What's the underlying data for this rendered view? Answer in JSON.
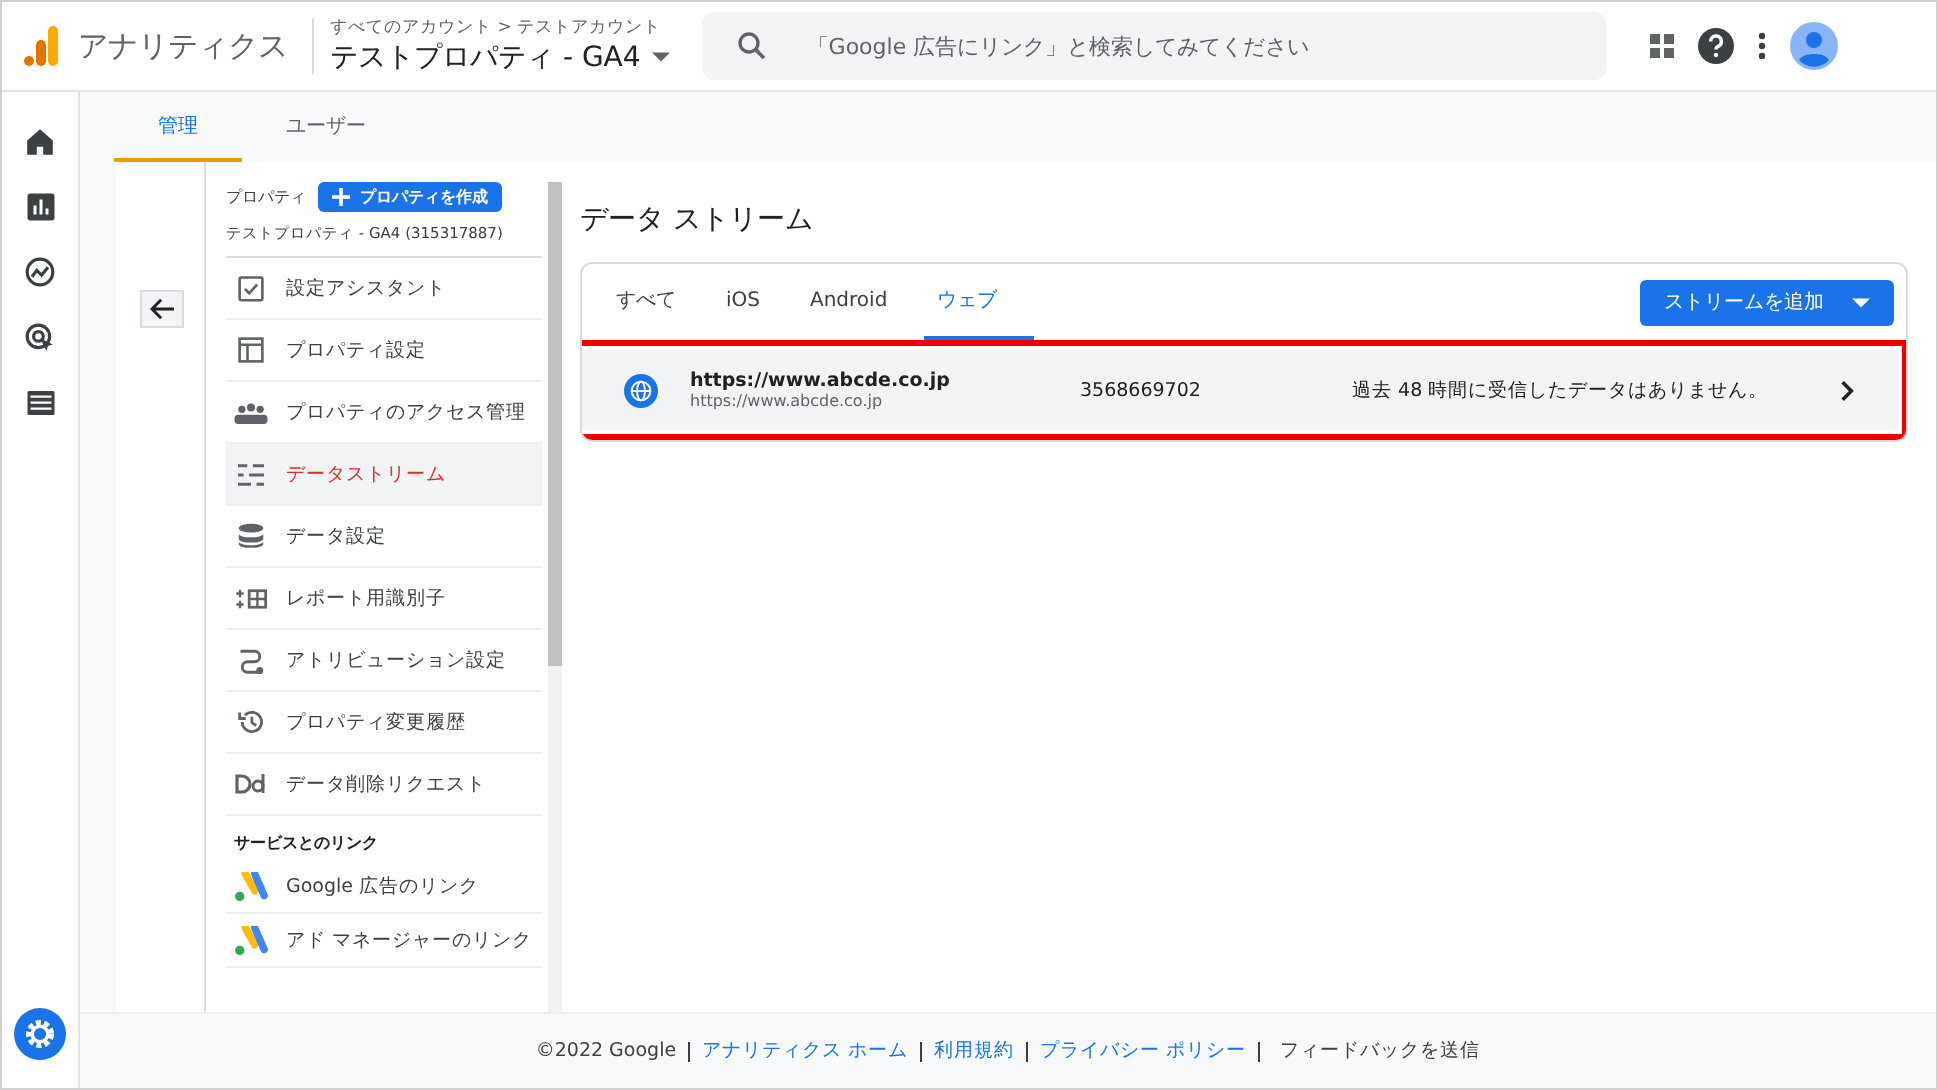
{
  "header": {
    "app_name": "アナリティクス",
    "breadcrumb": "すべてのアカウント > テストアカウント",
    "property": "テストプロパティ - GA4",
    "search": {
      "placeholder": "「Google 広告にリンク」と検索してみてください"
    }
  },
  "tabs": [
    {
      "label": "管理",
      "selected": true
    },
    {
      "label": "ユーザー",
      "selected": false
    }
  ],
  "sidebar": {
    "heading": "プロパティ",
    "create_button": "プロパティを作成",
    "property_name": "テストプロパティ - GA4 (315317887)",
    "items": [
      {
        "label": "設定アシスタント",
        "selected": false
      },
      {
        "label": "プロパティ設定",
        "selected": false
      },
      {
        "label": "プロパティのアクセス管理",
        "selected": false
      },
      {
        "label": "データストリーム",
        "selected": true
      },
      {
        "label": "データ設定",
        "selected": false
      },
      {
        "label": "レポート用識別子",
        "selected": false
      },
      {
        "label": "アトリビューション設定",
        "selected": false
      },
      {
        "label": "プロパティ変更履歴",
        "selected": false
      },
      {
        "label": "データ削除リクエスト",
        "selected": false
      }
    ],
    "links_heading": "サービスとのリンク",
    "links": [
      {
        "label": "Google 広告のリンク"
      },
      {
        "label": "アド マネージャーのリンク"
      }
    ]
  },
  "main": {
    "title": "データ ストリーム",
    "filters": [
      {
        "label": "すべて",
        "selected": false
      },
      {
        "label": "iOS",
        "selected": false
      },
      {
        "label": "Android",
        "selected": false
      },
      {
        "label": "ウェブ",
        "selected": true
      }
    ],
    "add_button": "ストリームを追加",
    "streams": [
      {
        "name": "https://www.abcde.co.jp",
        "url": "https://www.abcde.co.jp",
        "id": "3568669702",
        "status": "過去 48 時間に受信したデータはありません。",
        "highlighted": true
      }
    ]
  },
  "footer": {
    "copyright": "©2022 Google",
    "links": [
      "アナリティクス ホーム",
      "利用規約",
      "プライバシー ポリシー"
    ],
    "feedback": "フィードバックを送信"
  }
}
